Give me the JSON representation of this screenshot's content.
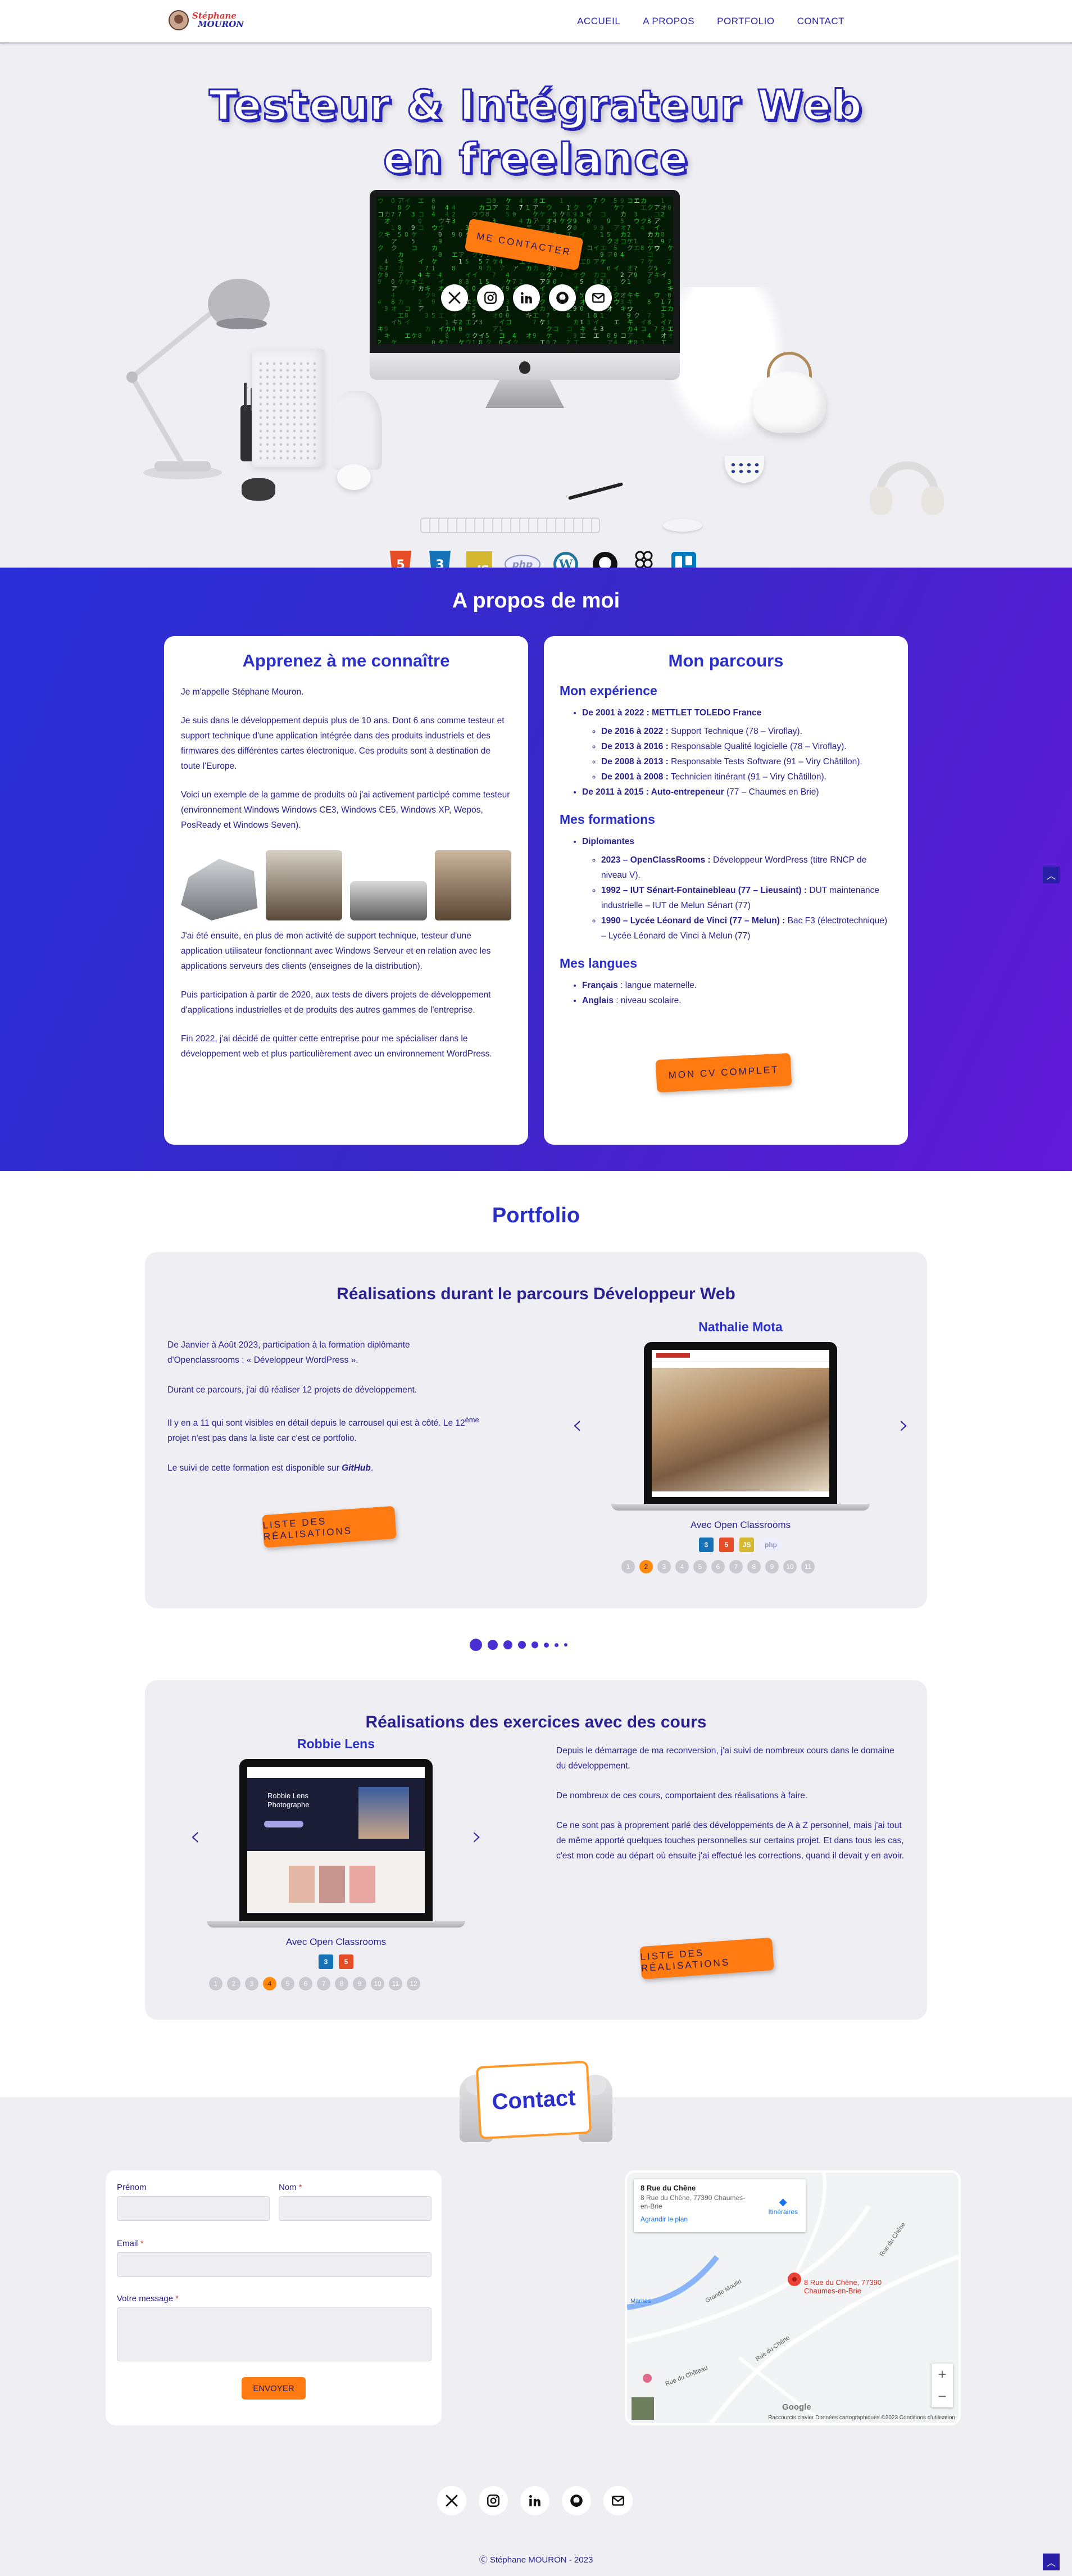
{
  "header": {
    "logo_line1": "Stéphane",
    "logo_line2": "MOURON",
    "nav": [
      "ACCUEIL",
      "A PROPOS",
      "PORTFOLIO",
      "CONTACT"
    ]
  },
  "hero": {
    "title_line1": "Testeur & Intégrateur Web",
    "title_line2": "en freelance",
    "cta": "ME CONTACTER",
    "socials": [
      "x-icon",
      "instagram-icon",
      "linkedin-icon",
      "github-icon",
      "mail-icon"
    ],
    "tech": [
      "html5",
      "css3",
      "js",
      "php",
      "wordpress",
      "github",
      "figma",
      "trello"
    ],
    "tech_labels": {
      "js": "JS",
      "php": "php"
    }
  },
  "about": {
    "title": "A propos de moi",
    "left_title": "Apprenez à me connaître",
    "left_paragraphs": [
      "Je m'appelle Stéphane Mouron.",
      "Je suis dans le développement depuis plus de 10 ans. Dont 6 ans comme testeur et support technique d'une application intégrée dans des produits industriels et des firmwares des différentes cartes électronique. Ces produits sont à destination de toute l'Europe.",
      "Voici un exemple de la gamme de produits où j'ai activement participé comme testeur (environnement Windows Windows CE3, Windows CE5, Windows XP, Wepos, PosReady et Windows Seven).",
      "J'ai été ensuite, en plus de mon activité de support technique, testeur d'une application utilisateur fonctionnant avec Windows Serveur et en relation avec les applications serveurs des clients (enseignes de la distribution).",
      "Puis participation à partir de 2020, aux tests de divers projets de développement d'applications industrielles et de produits des autres gammes de l'entreprise.",
      "Fin 2022, j'ai décidé de quitter cette entreprise pour me spécialiser dans le développement web et plus particulièrement avec un environnement WordPress."
    ],
    "right_title": "Mon parcours",
    "exp_title": "Mon expérience",
    "exp1_b": "De 2001 à 2022 : METTLET TOLEDO France",
    "exp1_sub": [
      {
        "b": "De 2016 à 2022 :",
        "t": " Support Technique (78 – Viroflay)."
      },
      {
        "b": "De 2013 à 2016 :",
        "t": " Responsable Qualité logicielle (78 – Viroflay)."
      },
      {
        "b": "De 2008 à 2013 :",
        "t": " Responsable Tests Software (91 – Viry Châtillon)."
      },
      {
        "b": "De 2001 à 2008 :",
        "t": " Technicien itinérant (91 – Viry Châtillon)."
      }
    ],
    "exp2_b": "De 2011 à 2015 : Auto-entrepeneur",
    "exp2_t": " (77 – Chaumes en Brie)",
    "form_title": "Mes formations",
    "form_head": "Diplomantes",
    "form_sub": [
      {
        "b": "2023 – OpenClassRooms :",
        "t": " Développeur WordPress (titre RNCP de niveau V)."
      },
      {
        "b": "1992 – IUT Sénart-Fontainebleau (77 – Lieusaint) :",
        "t": " DUT maintenance industrielle – IUT de Melun Sénart (77)"
      },
      {
        "b": "1990 – Lycée Léonard de Vinci (77 – Melun) :",
        "t": " Bac F3 (électrotechnique) – Lycée Léonard de Vinci à Melun (77)"
      }
    ],
    "lang_title": "Mes langues",
    "langs": [
      {
        "b": "Français",
        "t": " : langue maternelle."
      },
      {
        "b": "Anglais",
        "t": " : niveau scolaire."
      }
    ],
    "cv_button": "MON CV COMPLET"
  },
  "portfolio": {
    "title": "Portfolio",
    "card1": {
      "title": "Réalisations durant le parcours Développeur Web",
      "p1": "De Janvier à Août 2023, participation à la formation diplômante d'Openclassrooms : « Développeur WordPress ».",
      "p2": "Durant ce parcours, j'ai dû réaliser 12 projets de développement.",
      "p3a": "Il y en a 11 qui sont visibles en détail depuis le carrousel qui est à côté. Le 12",
      "p3sup": "ème",
      "p3b": " projet n'est pas dans la liste car c'est ce portfolio.",
      "p4a": "Le suivi de cette formation est disponible sur ",
      "p4b": "GitHub",
      "p4c": ".",
      "button": "LISTE DES RÉALISATIONS",
      "project": "Nathalie Mota",
      "avec": "Avec Open Classrooms",
      "tech": [
        "css3",
        "html5",
        "js",
        "php"
      ],
      "pages": [
        "1",
        "2",
        "3",
        "4",
        "5",
        "6",
        "7",
        "8",
        "9",
        "10",
        "11"
      ],
      "active_page": "2"
    },
    "card2": {
      "title": "Réalisations des exercices avec des cours",
      "p1": "Depuis le démarrage de ma reconversion, j'ai suivi de nombreux cours dans le domaine du développement.",
      "p2": "De nombreux de ces cours, comportaient des réalisations à faire.",
      "p3": "Ce ne sont pas à proprement parlé des développements de A à Z personnel, mais j'ai tout de même apporté quelques touches personnelles sur certains projet. Et dans tous les cas, c'est mon code au départ où ensuite j'ai effectué les corrections, quand il devait y en avoir.",
      "button": "LISTE DES RÉALISATIONS",
      "project": "Robbie Lens",
      "project_screen_title": "Robbie Lens\nPhotographe",
      "avec": "Avec Open Classrooms",
      "tech": [
        "css3",
        "html5"
      ],
      "pages": [
        "1",
        "2",
        "3",
        "4",
        "5",
        "6",
        "7",
        "8",
        "9",
        "10",
        "11",
        "12"
      ],
      "active_page": "4"
    }
  },
  "contact": {
    "title": "Contact",
    "first_name": "Prénom",
    "last_name": "Nom",
    "email": "Email",
    "message": "Votre message",
    "required_mark": "*",
    "send": "ENVOYER",
    "map": {
      "title": "8 Rue du Chêne",
      "address": "8 Rue du Chêne, 77390 Chaumes-en-Brie",
      "enlarge": "Agrandir le plan",
      "directions": "Itinéraires",
      "pin": "8 Rue du Chêne, 77390 Chaumes-en-Brie",
      "roads": [
        "Rue du Chêne",
        "Rue du Chêne",
        "Rue du Château",
        "Grande Moulin",
        "Marnes"
      ],
      "footer": "Raccourcis clavier    Données cartographiques ©2023    Conditions d'utilisation",
      "google": "Google"
    },
    "socials": [
      "x-icon",
      "instagram-icon",
      "linkedin-icon",
      "github-icon",
      "mail-icon"
    ],
    "copyright": "Ⓒ Stéphane MOURON - 2023"
  },
  "colors": {
    "primary": "#2a2fc9",
    "accent": "#ff7a10",
    "dark_text": "#2a2290"
  }
}
